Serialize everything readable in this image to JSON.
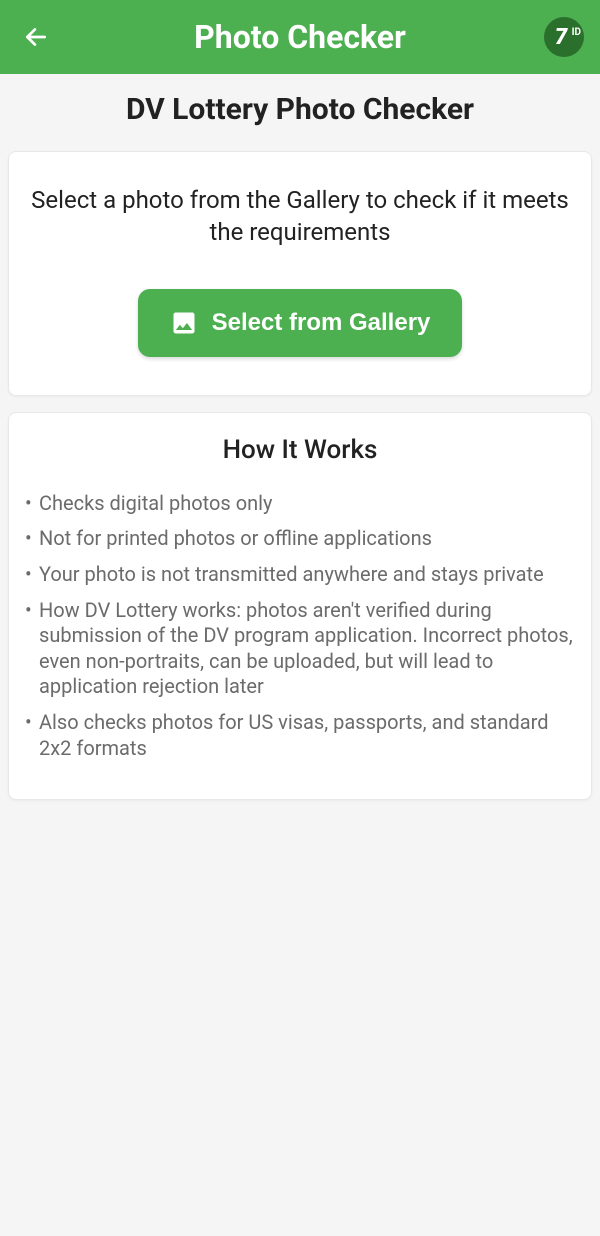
{
  "header": {
    "title": "Photo Checker",
    "logo_seven": "7",
    "logo_id": "ID"
  },
  "page_title": "DV Lottery Photo Checker",
  "select_card": {
    "prompt": "Select a photo from the Gallery to check if it meets the requirements",
    "button_label": "Select from Gallery"
  },
  "how_it_works": {
    "title": "How It Works",
    "items": [
      "Checks digital photos only",
      "Not for printed photos or offline applications",
      "Your photo is not transmitted anywhere and stays private",
      "How DV Lottery works: photos aren't verified during submission of the DV program application. Incorrect photos, even non-portraits, can be uploaded, but will lead to application rejection later",
      "Also checks photos for US visas, passports, and standard 2x2 formats"
    ]
  }
}
